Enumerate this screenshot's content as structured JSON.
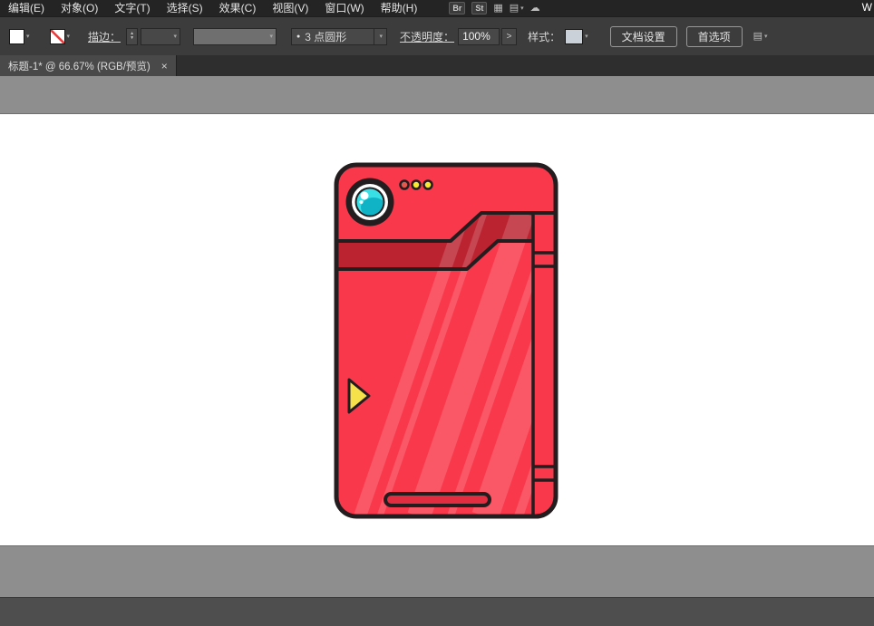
{
  "window": {
    "partial_letter": "W"
  },
  "menu": {
    "items": [
      "编辑(E)",
      "对象(O)",
      "文字(T)",
      "选择(S)",
      "效果(C)",
      "视图(V)",
      "窗口(W)",
      "帮助(H)"
    ],
    "badges": [
      "Br",
      "St"
    ]
  },
  "icons": {
    "chevron_down": "▾",
    "step_up": "▲",
    "step_down": "▼",
    "grid": "▦",
    "workspace": "▤",
    "cloud": "☁",
    "brush_dot": "●",
    "expand": ">"
  },
  "control_bar": {
    "stroke_label": "描边：",
    "brush_name": "3 点圆形",
    "opacity_label": "不透明度：",
    "opacity_value": "100%",
    "style_label": "样式：",
    "document_setup": "文档设置",
    "preferences": "首选项"
  },
  "document_tab": {
    "title": "标题-1* @ 66.67% (RGB/预览)",
    "close": "×"
  },
  "artwork": {
    "subject": "red pokedex-style device illustration",
    "colors": {
      "outline": "#241d1f",
      "body": "#f9394b",
      "shade": "#bc2331",
      "stripe": "rgba(255,255,255,0.16)",
      "lens_white": "#ffffff",
      "lens_cyan": "#38dfe5",
      "lens_cyan_dark": "#10b3c6",
      "indicator_1": "#e2574e",
      "indicator_2": "#f6e833",
      "indicator_3": "#f6e833",
      "speaker": "#e22c3f",
      "cursor": "#f6e14b"
    }
  }
}
